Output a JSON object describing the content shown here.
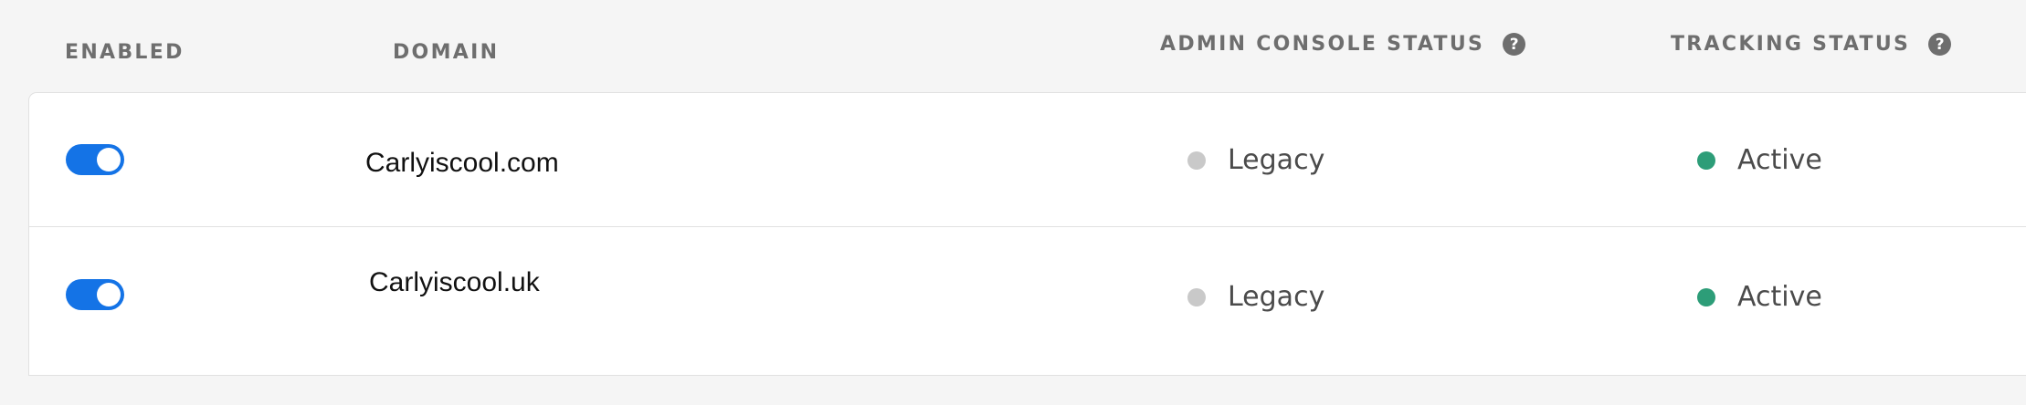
{
  "headers": {
    "enabled": "ENABLED",
    "domain": "DOMAIN",
    "admin_console_status": "ADMIN CONSOLE STATUS",
    "tracking_status": "TRACKING STATUS",
    "help_glyph": "?"
  },
  "rows": [
    {
      "enabled": true,
      "domain": "Carlyiscool.com",
      "admin_console_status": "Legacy",
      "tracking_status": "Active"
    },
    {
      "enabled": true,
      "domain": "Carlyiscool.uk",
      "admin_console_status": "Legacy",
      "tracking_status": "Active"
    }
  ],
  "icons": {
    "help": "help-circle-icon",
    "toggle": "toggle-switch",
    "status_dot": "status-dot-icon"
  },
  "colors": {
    "toggle_on": "#1473e6",
    "legacy_dot": "#c9c9c9",
    "active_dot": "#2d9d78",
    "header_text": "#6e6e6e"
  }
}
